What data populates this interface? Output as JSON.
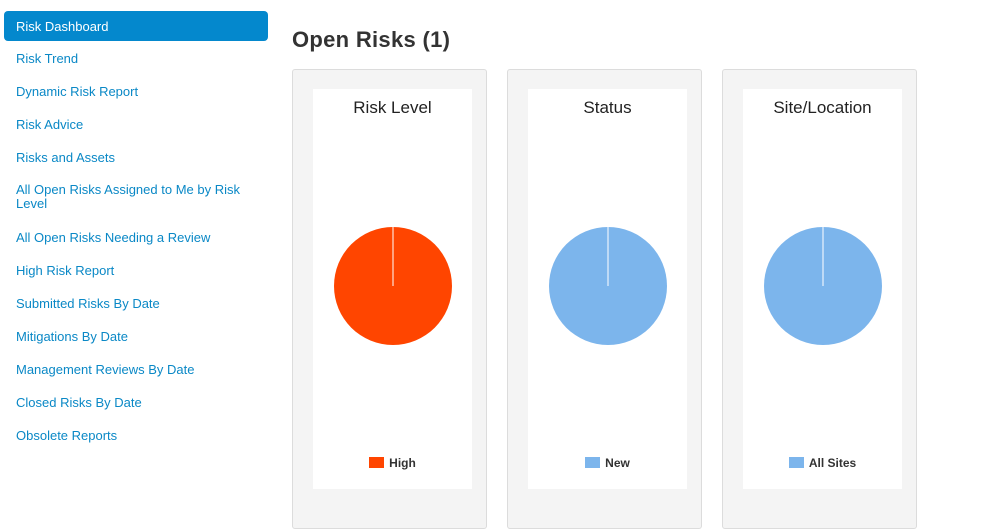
{
  "sidebar": {
    "items": [
      {
        "label": "Risk Dashboard",
        "active": true
      },
      {
        "label": "Risk Trend"
      },
      {
        "label": "Dynamic Risk Report"
      },
      {
        "label": "Risk Advice"
      },
      {
        "label": "Risks and Assets"
      },
      {
        "label": "All Open Risks Assigned to Me by Risk Level"
      },
      {
        "label": "All Open Risks Needing a Review"
      },
      {
        "label": "High Risk Report"
      },
      {
        "label": "Submitted Risks By Date"
      },
      {
        "label": "Mitigations By Date"
      },
      {
        "label": "Management Reviews By Date"
      },
      {
        "label": "Closed Risks By Date"
      },
      {
        "label": "Obsolete Reports"
      }
    ]
  },
  "main": {
    "title": "Open Risks (1)"
  },
  "chart_data": [
    {
      "type": "pie",
      "title": "Risk Level",
      "categories": [
        "High"
      ],
      "values": [
        1
      ],
      "colors": [
        "#ff4500"
      ],
      "legend": "bottom"
    },
    {
      "type": "pie",
      "title": "Status",
      "categories": [
        "New"
      ],
      "values": [
        1
      ],
      "colors": [
        "#7cb5ec"
      ],
      "legend": "bottom"
    },
    {
      "type": "pie",
      "title": "Site/Location",
      "categories": [
        "All Sites"
      ],
      "values": [
        1
      ],
      "colors": [
        "#7cb5ec"
      ],
      "legend": "bottom"
    }
  ],
  "colors": {
    "accent": "#0488cd",
    "link": "#0a88c6"
  }
}
